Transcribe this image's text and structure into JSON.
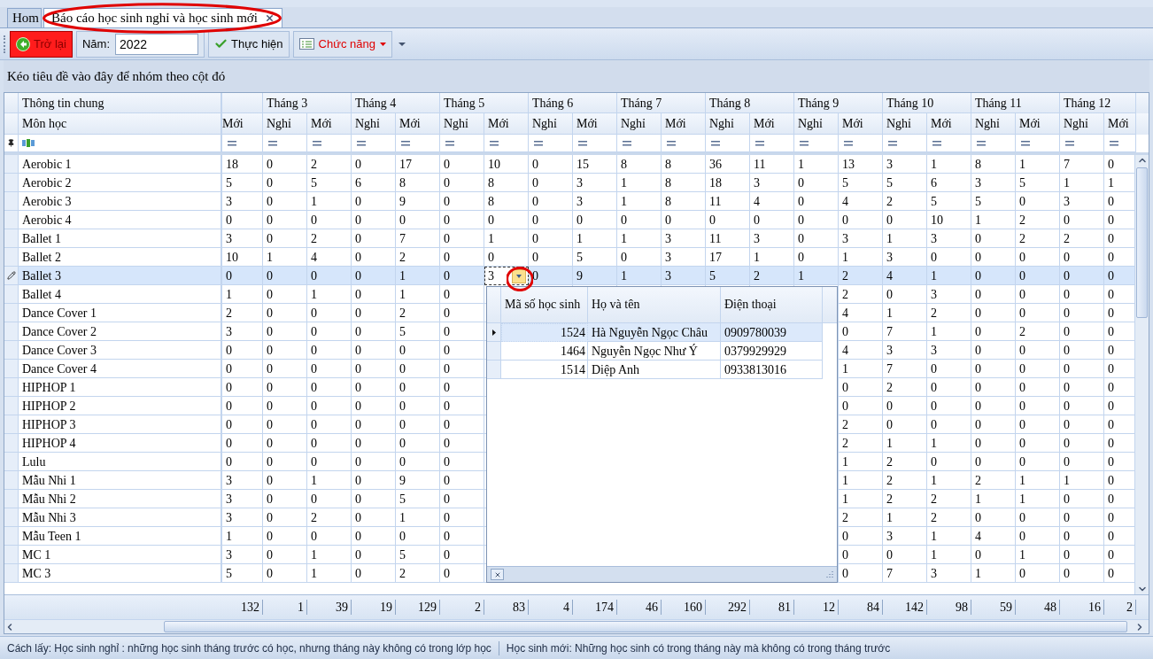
{
  "tabs": [
    {
      "label": "Hom",
      "selected": false,
      "highlighted": false
    },
    {
      "label": "Báo cáo học sinh nghỉ và học sinh mới",
      "selected": true,
      "highlighted": true
    }
  ],
  "toolbar": {
    "back_button": "Trở lại",
    "year_label": "Năm:",
    "year_value": "2022",
    "run_button": "Thực hiện",
    "function_menu": "Chức năng"
  },
  "group_panel": "Kéo tiêu đề vào đây để nhóm theo cột đó",
  "grid": {
    "info_band": "Thông tin chung",
    "month_bands": [
      "Tháng 3",
      "Tháng 4",
      "Tháng 5",
      "Tháng 6",
      "Tháng 7",
      "Tháng 8",
      "Tháng 9",
      "Tháng 10",
      "Tháng 11",
      "Tháng 12"
    ],
    "subject_column": "Môn học",
    "columns": [
      "Mới",
      "Nghỉ",
      "Mới",
      "Nghỉ",
      "Mới",
      "Nghỉ",
      "Mới",
      "Nghỉ",
      "Mới",
      "Nghỉ",
      "Mới",
      "Nghỉ",
      "Mới",
      "Nghỉ",
      "Mới",
      "Nghỉ",
      "Mới",
      "Nghỉ",
      "Mới",
      "Nghỉ",
      "Mới"
    ],
    "rows": [
      {
        "subject": "Aerobic 1",
        "selected": false,
        "cells": [
          "18",
          "0",
          "2",
          "0",
          "17",
          "0",
          "10",
          "0",
          "15",
          "8",
          "8",
          "36",
          "11",
          "1",
          "13",
          "3",
          "1",
          "8",
          "1",
          "7",
          "0"
        ]
      },
      {
        "subject": "Aerobic 2",
        "selected": false,
        "cells": [
          "5",
          "0",
          "5",
          "6",
          "8",
          "0",
          "8",
          "0",
          "3",
          "1",
          "8",
          "18",
          "3",
          "0",
          "5",
          "5",
          "6",
          "3",
          "5",
          "1",
          "1"
        ]
      },
      {
        "subject": "Aerobic 3",
        "selected": false,
        "cells": [
          "3",
          "0",
          "1",
          "0",
          "9",
          "0",
          "8",
          "0",
          "3",
          "1",
          "8",
          "11",
          "4",
          "0",
          "4",
          "2",
          "5",
          "5",
          "0",
          "3",
          "0"
        ]
      },
      {
        "subject": "Aerobic 4",
        "selected": false,
        "cells": [
          "0",
          "0",
          "0",
          "0",
          "0",
          "0",
          "0",
          "0",
          "0",
          "0",
          "0",
          "0",
          "0",
          "0",
          "0",
          "0",
          "10",
          "1",
          "2",
          "0",
          "0"
        ]
      },
      {
        "subject": "Ballet 1",
        "selected": false,
        "cells": [
          "3",
          "0",
          "2",
          "0",
          "7",
          "0",
          "1",
          "0",
          "1",
          "1",
          "3",
          "11",
          "3",
          "0",
          "3",
          "1",
          "3",
          "0",
          "2",
          "2",
          "0"
        ]
      },
      {
        "subject": "Ballet 2",
        "selected": false,
        "cells": [
          "10",
          "1",
          "4",
          "0",
          "2",
          "0",
          "0",
          "0",
          "5",
          "0",
          "3",
          "17",
          "1",
          "0",
          "1",
          "3",
          "0",
          "0",
          "0",
          "0",
          "0"
        ]
      },
      {
        "subject": "Ballet 3",
        "selected": true,
        "cells": [
          "0",
          "0",
          "0",
          "0",
          "1",
          "0",
          {
            "value": "3",
            "editor": true,
            "highlighted": true
          },
          "0",
          "9",
          "1",
          "3",
          "5",
          "2",
          "1",
          "2",
          "4",
          "1",
          "0",
          "0",
          "0",
          "0"
        ]
      },
      {
        "subject": "Ballet 4",
        "selected": false,
        "cells": [
          "1",
          "0",
          "1",
          "0",
          "1",
          "0",
          null,
          null,
          null,
          null,
          null,
          null,
          null,
          null,
          "2",
          "0",
          "3",
          "0",
          "0",
          "0",
          "0"
        ]
      },
      {
        "subject": "Dance Cover 1",
        "selected": false,
        "cells": [
          "2",
          "0",
          "0",
          "0",
          "2",
          "0",
          null,
          null,
          null,
          null,
          null,
          null,
          null,
          null,
          "4",
          "1",
          "2",
          "0",
          "0",
          "0",
          "0"
        ]
      },
      {
        "subject": "Dance Cover 2",
        "selected": false,
        "cells": [
          "3",
          "0",
          "0",
          "0",
          "5",
          "0",
          null,
          null,
          null,
          null,
          null,
          null,
          null,
          null,
          "0",
          "7",
          "1",
          "0",
          "2",
          "0",
          "0"
        ]
      },
      {
        "subject": "Dance Cover 3",
        "selected": false,
        "cells": [
          "0",
          "0",
          "0",
          "0",
          "0",
          "0",
          null,
          null,
          null,
          null,
          null,
          null,
          null,
          null,
          "4",
          "3",
          "3",
          "0",
          "0",
          "0",
          "0"
        ]
      },
      {
        "subject": "Dance Cover 4",
        "selected": false,
        "cells": [
          "0",
          "0",
          "0",
          "0",
          "0",
          "0",
          null,
          null,
          null,
          null,
          null,
          null,
          null,
          null,
          "1",
          "7",
          "0",
          "0",
          "0",
          "0",
          "0"
        ]
      },
      {
        "subject": "HIPHOP 1",
        "selected": false,
        "cells": [
          "0",
          "0",
          "0",
          "0",
          "0",
          "0",
          null,
          null,
          null,
          null,
          null,
          null,
          null,
          null,
          "0",
          "2",
          "0",
          "0",
          "0",
          "0",
          "0"
        ]
      },
      {
        "subject": "HIPHOP 2",
        "selected": false,
        "cells": [
          "0",
          "0",
          "0",
          "0",
          "0",
          "0",
          null,
          null,
          null,
          null,
          null,
          null,
          null,
          null,
          "0",
          "0",
          "0",
          "0",
          "0",
          "0",
          "0"
        ]
      },
      {
        "subject": "HIPHOP 3",
        "selected": false,
        "cells": [
          "0",
          "0",
          "0",
          "0",
          "0",
          "0",
          null,
          null,
          null,
          null,
          null,
          null,
          null,
          null,
          "2",
          "0",
          "0",
          "0",
          "0",
          "0",
          "0"
        ]
      },
      {
        "subject": "HIPHOP 4",
        "selected": false,
        "cells": [
          "0",
          "0",
          "0",
          "0",
          "0",
          "0",
          null,
          null,
          null,
          null,
          null,
          null,
          null,
          null,
          "2",
          "1",
          "1",
          "0",
          "0",
          "0",
          "0"
        ]
      },
      {
        "subject": "Lulu",
        "selected": false,
        "cells": [
          "0",
          "0",
          "0",
          "0",
          "0",
          "0",
          null,
          null,
          null,
          null,
          null,
          null,
          null,
          null,
          "1",
          "2",
          "0",
          "0",
          "0",
          "0",
          "0"
        ]
      },
      {
        "subject": "Mẫu Nhi 1",
        "selected": false,
        "cells": [
          "3",
          "0",
          "1",
          "0",
          "9",
          "0",
          null,
          null,
          null,
          null,
          null,
          null,
          null,
          null,
          "1",
          "2",
          "1",
          "2",
          "1",
          "1",
          "0"
        ]
      },
      {
        "subject": "Mẫu Nhi 2",
        "selected": false,
        "cells": [
          "3",
          "0",
          "0",
          "0",
          "5",
          "0",
          null,
          null,
          null,
          null,
          null,
          null,
          null,
          null,
          "1",
          "2",
          "2",
          "1",
          "1",
          "0",
          "0"
        ]
      },
      {
        "subject": "Mẫu Nhi 3",
        "selected": false,
        "cells": [
          "3",
          "0",
          "2",
          "0",
          "1",
          "0",
          null,
          null,
          null,
          null,
          null,
          null,
          null,
          null,
          "2",
          "1",
          "2",
          "0",
          "0",
          "0",
          "0"
        ]
      },
      {
        "subject": "Mẫu Teen 1",
        "selected": false,
        "cells": [
          "1",
          "0",
          "0",
          "0",
          "0",
          "0",
          null,
          null,
          null,
          null,
          null,
          null,
          null,
          null,
          "0",
          "3",
          "1",
          "4",
          "0",
          "0",
          "0"
        ]
      },
      {
        "subject": "MC 1",
        "selected": false,
        "cells": [
          "3",
          "0",
          "1",
          "0",
          "5",
          "0",
          null,
          null,
          null,
          null,
          null,
          null,
          null,
          null,
          "0",
          "0",
          "1",
          "0",
          "1",
          "0",
          "0"
        ]
      },
      {
        "subject": "MC 3",
        "selected": false,
        "cells": [
          "5",
          "0",
          "1",
          "0",
          "2",
          "0",
          null,
          null,
          null,
          null,
          null,
          null,
          null,
          null,
          "0",
          "7",
          "3",
          "1",
          "0",
          "0",
          "0"
        ]
      }
    ],
    "totals": [
      "132",
      "1",
      "39",
      "19",
      "129",
      "2",
      "83",
      "4",
      "174",
      "46",
      "160",
      "292",
      "81",
      "12",
      "84",
      "142",
      "98",
      "59",
      "48",
      "16",
      "2"
    ]
  },
  "popup": {
    "columns": [
      "Mã số học sinh",
      "Họ và tên",
      "Điện thoại"
    ],
    "rows": [
      {
        "id": "1524",
        "name": "Hà Nguyễn Ngọc Châu",
        "phone": "0909780039",
        "selected": true
      },
      {
        "id": "1464",
        "name": "Nguyễn Ngọc Như Ý",
        "phone": "0379929929",
        "selected": false
      },
      {
        "id": "1514",
        "name": "Diệp Anh",
        "phone": "0933813016",
        "selected": false
      }
    ]
  },
  "status_bar": [
    "Cách lấy: Học sinh nghỉ : những học sinh tháng trước có học, nhưng tháng này không có trong lớp học",
    "Học sinh mới: Những học sinh có trong tháng này mà không có trong tháng trước"
  ]
}
